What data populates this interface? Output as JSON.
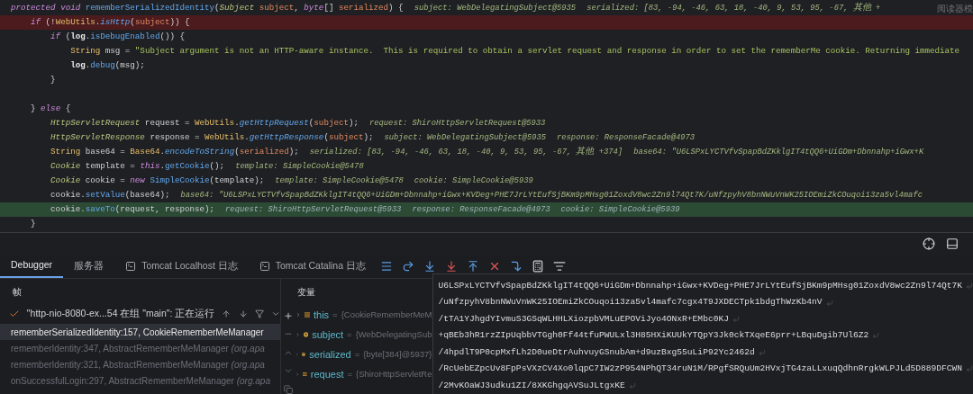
{
  "editor": {
    "reader_mode_label": "阅读器模",
    "lines": [
      {
        "breakpoint": false,
        "execution_point": false,
        "tokens": [
          {
            "kind": "kw",
            "text": "protected void "
          },
          {
            "kind": "method",
            "text": "rememberSerializedIdentity"
          },
          {
            "kind": "plain",
            "text": "("
          },
          {
            "kind": "type",
            "text": "Subject "
          },
          {
            "kind": "param",
            "text": "subject"
          },
          {
            "kind": "plain",
            "text": ", "
          },
          {
            "kind": "kw",
            "text": "byte"
          },
          {
            "kind": "plain",
            "text": "[] "
          },
          {
            "kind": "param",
            "text": "serialized"
          },
          {
            "kind": "plain",
            "text": ") {"
          }
        ],
        "hints": [
          "subject: WebDelegatingSubject@5935",
          "serialized: [83, -94, -46, 63, 18, -40, 9, 53, 95, -67, 其他 +"
        ]
      },
      {
        "breakpoint": true,
        "execution_point": false,
        "tokens": [
          {
            "kind": "kw",
            "text": "    if"
          },
          {
            "kind": "plain",
            "text": " (!"
          },
          {
            "kind": "cls",
            "text": "WebUtils"
          },
          {
            "kind": "plain",
            "text": "."
          },
          {
            "kind": "smethod",
            "text": "isHttp"
          },
          {
            "kind": "plain",
            "text": "("
          },
          {
            "kind": "param",
            "text": "subject"
          },
          {
            "kind": "plain",
            "text": ")) {"
          }
        ]
      },
      {
        "breakpoint": false,
        "execution_point": false,
        "tokens": [
          {
            "kind": "kw",
            "text": "        if"
          },
          {
            "kind": "plain",
            "text": " ("
          },
          {
            "kind": "field",
            "text": "log"
          },
          {
            "kind": "plain",
            "text": "."
          },
          {
            "kind": "method",
            "text": "isDebugEnabled"
          },
          {
            "kind": "plain",
            "text": "()) {"
          }
        ]
      },
      {
        "breakpoint": false,
        "execution_point": false,
        "tokens": [
          {
            "kind": "cls",
            "text": "            String"
          },
          {
            "kind": "plain",
            "text": " msg = "
          },
          {
            "kind": "str",
            "text": "\"Subject argument is not an HTTP-aware instance.  This is required to obtain a servlet request and response in order to set the rememberMe cookie. Returning immediate"
          }
        ]
      },
      {
        "breakpoint": false,
        "execution_point": false,
        "tokens": [
          {
            "kind": "field",
            "text": "            log"
          },
          {
            "kind": "plain",
            "text": "."
          },
          {
            "kind": "method",
            "text": "debug"
          },
          {
            "kind": "plain",
            "text": "(msg);"
          }
        ]
      },
      {
        "breakpoint": false,
        "execution_point": false,
        "tokens": [
          {
            "kind": "plain",
            "text": "        }"
          }
        ]
      },
      {
        "breakpoint": false,
        "execution_point": false
      },
      {
        "breakpoint": false,
        "execution_point": false,
        "tokens": [
          {
            "kind": "plain",
            "text": "    } "
          },
          {
            "kind": "kw",
            "text": "else"
          },
          {
            "kind": "plain",
            "text": " {"
          }
        ]
      },
      {
        "breakpoint": false,
        "execution_point": false,
        "tokens": [
          {
            "kind": "type",
            "text": "        HttpServletRequest"
          },
          {
            "kind": "plain",
            "text": " request = "
          },
          {
            "kind": "cls",
            "text": "WebUtils"
          },
          {
            "kind": "plain",
            "text": "."
          },
          {
            "kind": "smethod",
            "text": "getHttpRequest"
          },
          {
            "kind": "plain",
            "text": "("
          },
          {
            "kind": "param",
            "text": "subject"
          },
          {
            "kind": "plain",
            "text": ");"
          }
        ],
        "hints": [
          "request: ShiroHttpServletRequest@5933"
        ]
      },
      {
        "breakpoint": false,
        "execution_point": false,
        "tokens": [
          {
            "kind": "type",
            "text": "        HttpServletResponse"
          },
          {
            "kind": "plain",
            "text": " response = "
          },
          {
            "kind": "cls",
            "text": "WebUtils"
          },
          {
            "kind": "plain",
            "text": "."
          },
          {
            "kind": "smethod",
            "text": "getHttpResponse"
          },
          {
            "kind": "plain",
            "text": "("
          },
          {
            "kind": "param",
            "text": "subject"
          },
          {
            "kind": "plain",
            "text": ");"
          }
        ],
        "hints": [
          "subject: WebDelegatingSubject@5935",
          "response: ResponseFacade@4973"
        ]
      },
      {
        "breakpoint": false,
        "execution_point": false,
        "tokens": [
          {
            "kind": "cls",
            "text": "        String"
          },
          {
            "kind": "plain",
            "text": " base64 = "
          },
          {
            "kind": "cls",
            "text": "Base64"
          },
          {
            "kind": "plain",
            "text": "."
          },
          {
            "kind": "smethod",
            "text": "encodeToString"
          },
          {
            "kind": "plain",
            "text": "("
          },
          {
            "kind": "param",
            "text": "serialized"
          },
          {
            "kind": "plain",
            "text": ");"
          }
        ],
        "hints": [
          "serialized: [83, -94, -46, 63, 18, -40, 9, 53, 95, -67, 其他 +374]",
          "base64: \"U6LSPxLYCTVfvSpapBdZKklgIT4tQQ6+UiGDm+Dbnnahp+iGwx+K"
        ]
      },
      {
        "breakpoint": false,
        "execution_point": false,
        "tokens": [
          {
            "kind": "type",
            "text": "        Cookie"
          },
          {
            "kind": "plain",
            "text": " template = "
          },
          {
            "kind": "kw",
            "text": "this"
          },
          {
            "kind": "plain",
            "text": "."
          },
          {
            "kind": "method",
            "text": "getCookie"
          },
          {
            "kind": "plain",
            "text": "();"
          }
        ],
        "hints": [
          "template: SimpleCookie@5478"
        ]
      },
      {
        "breakpoint": false,
        "execution_point": false,
        "tokens": [
          {
            "kind": "type",
            "text": "        Cookie"
          },
          {
            "kind": "plain",
            "text": " cookie = "
          },
          {
            "kind": "kw",
            "text": "new "
          },
          {
            "kind": "method",
            "text": "SimpleCookie"
          },
          {
            "kind": "plain",
            "text": "(template);"
          }
        ],
        "hints": [
          "template: SimpleCookie@5478",
          "cookie: SimpleCookie@5939"
        ]
      },
      {
        "breakpoint": false,
        "execution_point": false,
        "tokens": [
          {
            "kind": "plain",
            "text": "        cookie."
          },
          {
            "kind": "method",
            "text": "setValue"
          },
          {
            "kind": "plain",
            "text": "(base64);"
          }
        ],
        "hints": [
          "base64: \"U6LSPxLYCTVfvSpapBdZKklgIT4tQQ6+UiGDm+Dbnnahp+iGwx+KVDeg+PHE7JrLYtEufSjBKm9pMHsg01ZoxdV8wc2Zn9l74Qt7K/uNfzpyhV8bnNWuVnWK25IOEmiZkCOuqoi13za5vl4mafc"
        ]
      },
      {
        "breakpoint": false,
        "execution_point": true,
        "tokens": [
          {
            "kind": "plain",
            "text": "        cookie."
          },
          {
            "kind": "method",
            "text": "saveTo"
          },
          {
            "kind": "plain",
            "text": "(request, response);"
          }
        ],
        "hints": [
          "request: ShiroHttpServletRequest@5933",
          "response: ResponseFacade@4973",
          "cookie: SimpleCookie@5939"
        ]
      },
      {
        "breakpoint": false,
        "execution_point": false,
        "tokens": [
          {
            "kind": "plain",
            "text": "    }"
          }
        ]
      }
    ]
  },
  "tool_window": {
    "tabs": [
      {
        "label": "Debugger",
        "selected": true,
        "console_icon": false
      },
      {
        "label": "服务器",
        "selected": false,
        "console_icon": false
      },
      {
        "label": "Tomcat Localhost 日志",
        "selected": false,
        "console_icon": true
      },
      {
        "label": "Tomcat Catalina 日志",
        "selected": false,
        "console_icon": true
      }
    ],
    "frames_header": "帧",
    "thread": "\"http-nio-8080-ex...54 在组 \"main\": 正在运行",
    "frames": [
      {
        "method": "rememberSerializedIdentity:157, CookieRememberMeManager",
        "selected": true
      },
      {
        "method": "rememberIdentity:347, AbstractRememberMeManager ",
        "location": "(org.apa",
        "selected": false
      },
      {
        "method": "rememberIdentity:321, AbstractRememberMeManager ",
        "location": "(org.apa",
        "selected": false
      },
      {
        "method": "onSuccessfulLogin:297, AbstractRememberMeManager ",
        "location": "(org.apa",
        "selected": false
      }
    ],
    "variables_header": "变量",
    "variables": [
      {
        "kind": "field",
        "name": "this",
        "operator": "=",
        "value": "{CookieRememberMeM"
      },
      {
        "kind": "param",
        "name": "subject",
        "operator": "=",
        "value": "{WebDelegatingSub"
      },
      {
        "kind": "param",
        "name": "serialized",
        "operator": "=",
        "value": "{byte[384]@5937}"
      },
      {
        "kind": "field",
        "name": "request",
        "operator": "=",
        "value": "{ShiroHttpServletRe"
      }
    ],
    "value_popup": [
      "U6LSPxLYCTVfvSpapBdZKklgIT4tQQ6+UiGDm+Dbnnahp+iGwx+KVDeg+PHE7JrLYtEufSjBKm9pMHsg01ZoxdV8wc2Zn9l74Qt7K",
      "/uNfzpyhV8bnNWuVnWK25IOEmiZkCOuqoi13za5vl4mafc7cgx4T9JXDECTpk1bdgThWzKb4nV",
      "/tTA1YJhgdYIvmuS3GSqWLHHLXiozpbVMLuEPOViJyo4ONxR+EMbc0KJ",
      "+qBEb3hR1rzZIpUqbbVTGgh0Ff44tfuPWULxl3H85HXiKUUkYTQpY3Jk0ckTXqeE6prr+LBquDgib7Ul6Z2",
      "/4hpdlT9P0cpMxfLh2D0ueDtrAuhvuyGSnubAm+d9uzBxg55uLiP92Yc2462d",
      "/RcUebEZpcUv8FpPsVXzCV4Xo0lqpC7IW2zP954NPhQT34ruN1M/RPgfSRQuUm2HVxjTG4zaLLxuqQdhnRrgkWLPJLd5D889DFCWN",
      "/2MvKOaWJ3udku1ZI/8XKGhgqAVSuJLtgxKE"
    ]
  }
}
